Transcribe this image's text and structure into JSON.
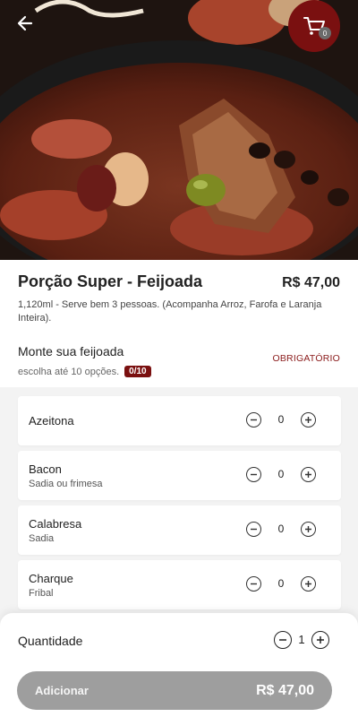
{
  "header": {
    "back_icon": "arrow-left-icon",
    "cart_icon": "shopping-cart-icon",
    "cart_count": "0",
    "brand_color": "#7a1010"
  },
  "product": {
    "title": "Porção Super - Feijoada",
    "price": "R$ 47,00",
    "description": "1,120ml - Serve bem 3 pessoas. (Acompanha Arroz, Farofa e Laranja Inteira)."
  },
  "group": {
    "title": "Monte sua feijoada",
    "subtitle": "escolha até 10 opções.",
    "count": "0/10",
    "required_label": "OBRIGATÓRIO"
  },
  "options": [
    {
      "name": "Azeitona",
      "sub": "",
      "qty": "0"
    },
    {
      "name": "Bacon",
      "sub": "Sadia ou frimesa",
      "qty": "0"
    },
    {
      "name": "Calabresa",
      "sub": "Sadia",
      "qty": "0"
    },
    {
      "name": "Charque",
      "sub": "Fribal",
      "qty": "0"
    }
  ],
  "footer": {
    "quantity_label": "Quantidade",
    "quantity": "1",
    "add_label": "Adicionar",
    "add_price": "R$ 47,00",
    "button_color": "#9e9e9e"
  }
}
